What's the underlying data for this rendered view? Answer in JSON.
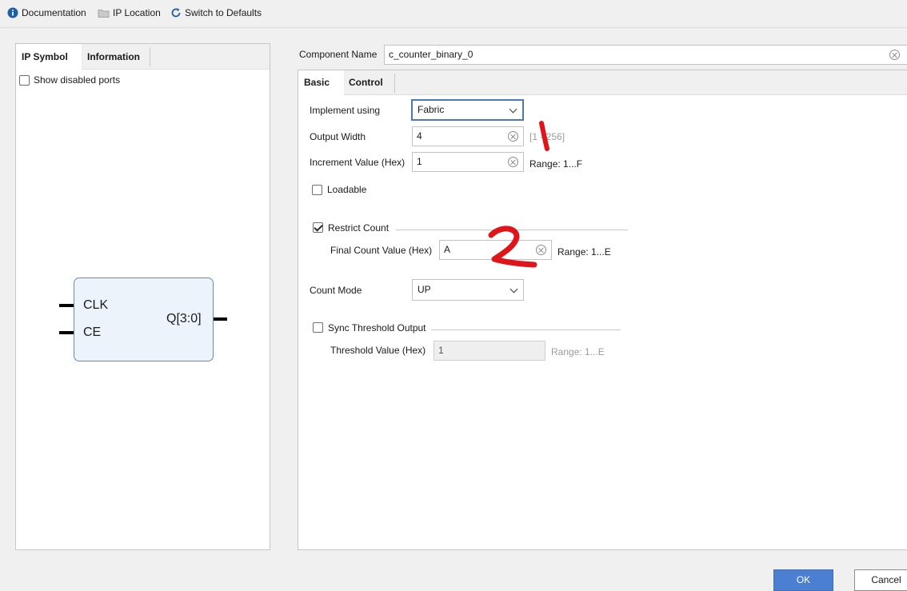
{
  "toolbar": {
    "documentation": "Documentation",
    "ip_location": "IP Location",
    "switch_defaults": "Switch to Defaults"
  },
  "left_panel": {
    "tabs": [
      {
        "label": "IP Symbol"
      },
      {
        "label": "Information"
      }
    ],
    "show_disabled_ports": "Show disabled ports",
    "symbol": {
      "pins_in": [
        "CLK",
        "CE"
      ],
      "pin_out": "Q[3:0]"
    }
  },
  "component": {
    "label": "Component Name",
    "value": "c_counter_binary_0"
  },
  "tabs": [
    {
      "label": "Basic"
    },
    {
      "label": "Control"
    }
  ],
  "basic": {
    "implement_using": {
      "label": "Implement using",
      "value": "Fabric"
    },
    "output_width": {
      "label": "Output Width",
      "value": "4",
      "range": "[1 - 256]"
    },
    "increment_value": {
      "label": "Increment Value (Hex)",
      "value": "1",
      "range": "Range: 1...F"
    },
    "loadable": {
      "label": "Loadable"
    },
    "restrict_count": {
      "label": "Restrict Count"
    },
    "final_count": {
      "label": "Final Count Value (Hex)",
      "value": "A",
      "range": "Range: 1...E"
    },
    "count_mode": {
      "label": "Count Mode",
      "value": "UP"
    },
    "sync_threshold": {
      "label": "Sync Threshold Output"
    },
    "threshold_value": {
      "label": "Threshold Value (Hex)",
      "value": "1",
      "range": "Range: 1...E"
    }
  },
  "annotations": [
    "1",
    "2"
  ],
  "buttons": {
    "ok": "OK",
    "cancel": "Cancel"
  },
  "colors": {
    "accent": "#4a7fd1",
    "annotation": "#e0151a",
    "symbol_fill": "#ecf3fb"
  }
}
